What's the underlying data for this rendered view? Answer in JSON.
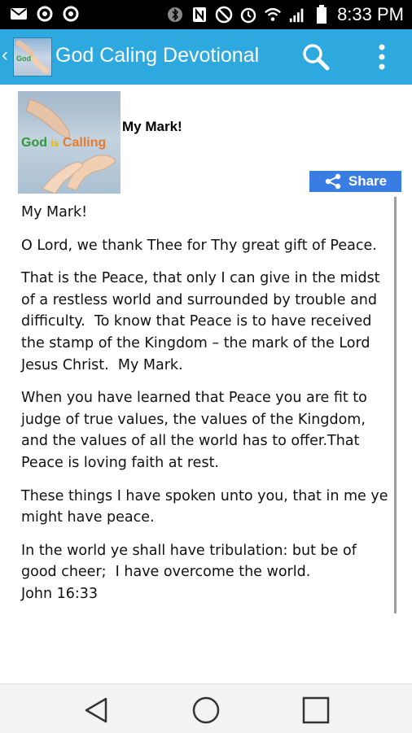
{
  "status_bar": {
    "time": "8:33 PM",
    "icons": [
      "mail-icon",
      "notification-icon",
      "notification-icon",
      "bluetooth-icon",
      "nfc-icon",
      "mute-icon",
      "alarm-icon",
      "wifi-icon",
      "signal-icon",
      "battery-icon"
    ]
  },
  "app_bar": {
    "title": "God Caling Devotional",
    "icons": [
      "back-icon",
      "app-icon",
      "search-icon",
      "overflow-menu-icon"
    ]
  },
  "header": {
    "thumbnail_caption_words": [
      "God",
      "is",
      "Calling"
    ],
    "title": "My Mark!"
  },
  "share": {
    "label": "Share",
    "icon": "share-icon"
  },
  "article": {
    "paragraphs": [
      "My Mark!",
      "O Lord, we thank Thee for Thy great gift of Peace.",
      "That is the Peace, that only I can give in the midst of a restless world and surrounded by trouble and difficulty.  To know that Peace is to have received the stamp of the Kingdom – the mark of the Lord Jesus Christ.  My Mark.",
      "When you have learned that Peace you are fit to judge of true values, the values of the Kingdom, and the values of all the world has to offer.That Peace is loving faith at rest.",
      "These things I have spoken unto you, that in me ye might have peace.",
      "In the world ye shall have tribulation: but be of good cheer;  I have overcome the world.\nJohn 16:33"
    ]
  },
  "nav_bar": {
    "icons": [
      "back-triangle-icon",
      "home-circle-icon",
      "recents-square-icon"
    ]
  },
  "colors": {
    "app_bar": "#2ea9df",
    "share_button": "#3a7de2",
    "status_bar": "#000000"
  }
}
